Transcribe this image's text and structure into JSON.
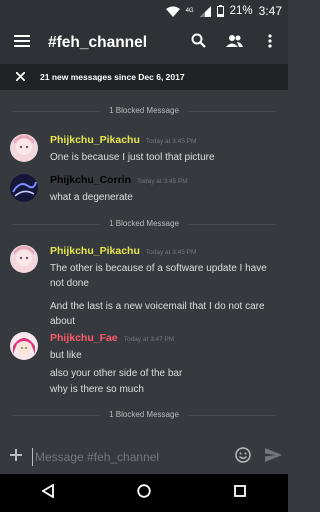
{
  "status_bar": {
    "battery_percent": "21%",
    "time": "3:47",
    "network_label": "4G"
  },
  "header": {
    "title": "#feh_channel",
    "icons": [
      "menu-icon",
      "search-icon",
      "members-icon",
      "more-icon"
    ]
  },
  "banner": {
    "text": "21 new messages since Dec 6, 2017"
  },
  "blocked_label": "1 Blocked Message",
  "messages": [
    {
      "author": "Phijkchu_Pikachu",
      "time": "Today at 3:45 PM",
      "color": "#e6e64f",
      "lines": [
        "One is because I just tool that picture"
      ]
    },
    {
      "author": "Phijkchu_Corrin",
      "time": "Today at 3:45 PM",
      "color": "#000000",
      "lines": [
        "what a degenerate"
      ]
    },
    {
      "author": "Phijkchu_Pikachu",
      "time": "Today at 3:45 PM",
      "color": "#e6e64f",
      "lines": [
        "The other is because of a software update I have not done",
        "And the last is a new voicemail that I do not care about"
      ]
    },
    {
      "author": "Phijkchu_Fae",
      "time": "Today at 3:47 PM",
      "color": "#ff5a6e",
      "lines": [
        "but like",
        "also your other side of the bar",
        "why is there so much"
      ]
    }
  ],
  "composer": {
    "placeholder": "Message #feh_channel"
  },
  "colors": {
    "background": "#36393e",
    "appbar": "#2f3136",
    "banner": "#202225"
  }
}
